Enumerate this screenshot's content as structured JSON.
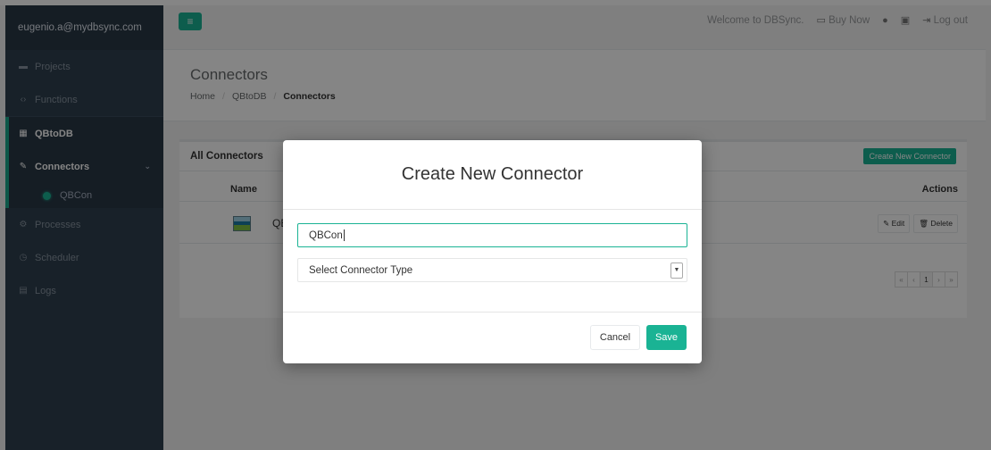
{
  "sidebar": {
    "user_email": "eugenio.a@mydbsync.com",
    "items": [
      {
        "label": "Projects",
        "icon": "projects-icon"
      },
      {
        "label": "Functions",
        "icon": "code-icon"
      },
      {
        "label": "QBtoDB",
        "icon": "grid-icon"
      },
      {
        "label": "Connectors",
        "icon": "plug-icon"
      },
      {
        "label": "Processes",
        "icon": "cogs-icon"
      },
      {
        "label": "Scheduler",
        "icon": "clock-icon"
      },
      {
        "label": "Logs",
        "icon": "file-icon"
      }
    ],
    "subitem": "QBCon"
  },
  "topbar": {
    "welcome": "Welcome to DBSync.",
    "buy_now": "Buy Now",
    "logout": "Log out"
  },
  "page": {
    "title": "Connectors",
    "breadcrumb": [
      "Home",
      "QBtoDB",
      "Connectors"
    ]
  },
  "panel": {
    "title": "All Connectors",
    "create_button": "Create New Connector",
    "columns": [
      "Name",
      "Actions"
    ],
    "row_name": "QBCon",
    "edit": "Edit",
    "delete": "Delete",
    "pager": [
      "«",
      "‹",
      "1",
      "›",
      "»"
    ]
  },
  "modal": {
    "title": "Create New Connector",
    "name_value": "QBCon",
    "select_placeholder": "Select Connector Type",
    "cancel": "Cancel",
    "save": "Save"
  },
  "colors": {
    "accent": "#1ab394",
    "sidebar": "#2f4050"
  }
}
